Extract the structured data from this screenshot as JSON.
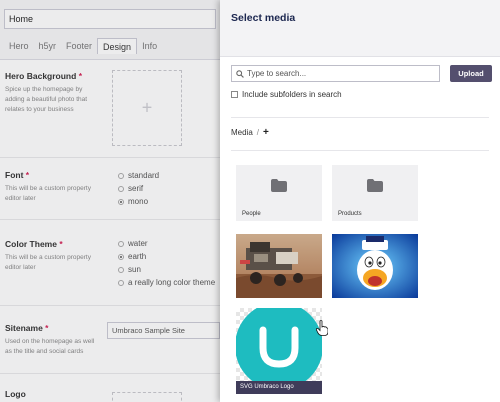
{
  "editor": {
    "name_value": "Home",
    "tabs": [
      {
        "label": "Hero",
        "active": false
      },
      {
        "label": "h5yr",
        "active": false
      },
      {
        "label": "Footer",
        "active": false
      },
      {
        "label": "Design",
        "active": true
      },
      {
        "label": "Info",
        "active": false
      }
    ],
    "hero_background": {
      "label": "Hero Background",
      "required_mark": "*",
      "description": "Spice up the homepage by adding a beautiful photo that relates to your business"
    },
    "font": {
      "label": "Font",
      "required_mark": "*",
      "description": "This will be a custom property editor later",
      "options": [
        "standard",
        "serif",
        "mono"
      ],
      "selected": "mono"
    },
    "color_theme": {
      "label": "Color Theme",
      "required_mark": "*",
      "description": "This will be a custom property editor later",
      "options": [
        "water",
        "earth",
        "sun",
        "a really long color theme"
      ],
      "selected": "earth"
    },
    "sitename": {
      "label": "Sitename",
      "required_mark": "*",
      "description": "Used on the homepage as well as the title and social cards",
      "value": "Umbraco Sample Site"
    },
    "logo": {
      "label": "Logo"
    }
  },
  "media_picker": {
    "title": "Select media",
    "search_placeholder": "Type to search...",
    "upload_label": "Upload",
    "include_subfolders_label": "Include subfolders in search",
    "breadcrumb_root": "Media",
    "breadcrumb_separator": "/",
    "add_folder_label": "+",
    "folders": [
      {
        "label": "People"
      },
      {
        "label": "Products"
      }
    ],
    "svg_item_label": "SVG Umbraco Logo",
    "colors": {
      "accent": "#544f6e",
      "umbraco_teal": "#1ebcc0",
      "header_bg": "#f3f3f5",
      "title": "#1b264f"
    }
  }
}
